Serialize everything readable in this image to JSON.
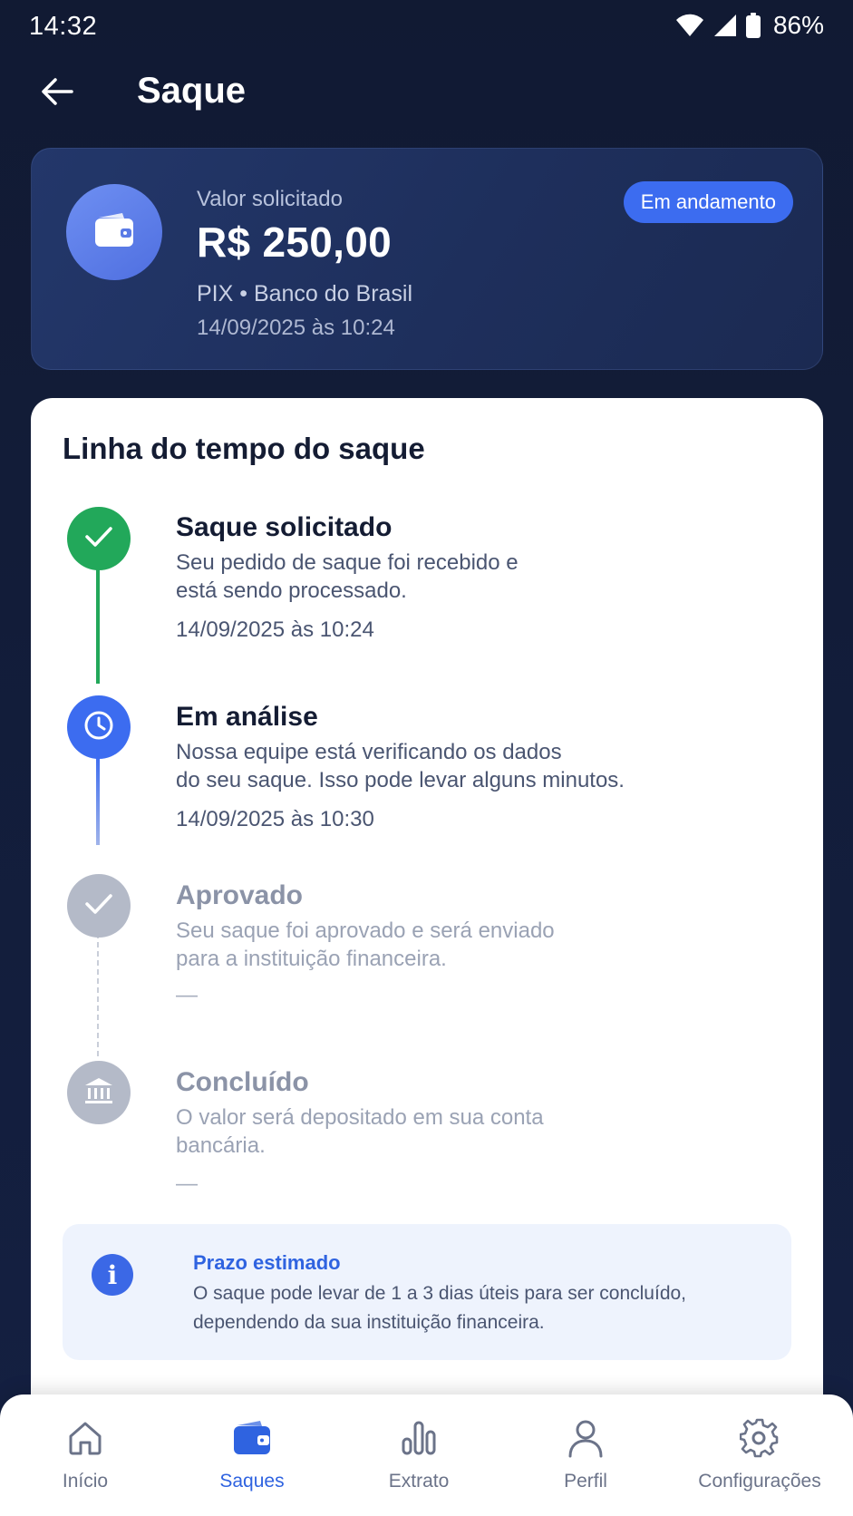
{
  "status_bar": {
    "time": "14:32",
    "battery": "86%"
  },
  "header": {
    "title": "Saque",
    "back_icon": "arrow-left-icon"
  },
  "summary": {
    "label": "Valor solicitado",
    "amount": "R$ 250,00",
    "method": "PIX • Banco do Brasil",
    "date": "14/09/2025  às 10:24",
    "status": "Em andamento",
    "icon": "wallet-icon"
  },
  "timeline": {
    "title": "Linha do tempo do saque",
    "steps": [
      {
        "title": "Saque solicitado",
        "desc_line1": "Seu pedido de saque foi recebido e",
        "desc_line2": "está sendo processado.",
        "date": "14/09/2025  às 10:24",
        "state": "done",
        "icon": "check-icon"
      },
      {
        "title": "Em análise",
        "desc_line1": "Nossa equipe está verificando os dados",
        "desc_line2": "do seu saque. Isso pode levar alguns minutos.",
        "date": "14/09/2025  às 10:30",
        "state": "current",
        "icon": "clock-icon"
      },
      {
        "title": "Aprovado",
        "desc_line1": "Seu saque foi aprovado e será enviado",
        "desc_line2": "para a instituição financeira.",
        "date": "—",
        "state": "pending",
        "icon": "check-icon"
      },
      {
        "title": "Concluído",
        "desc_line1": "O valor será depositado em sua conta",
        "desc_line2": "bancária.",
        "date": "—",
        "state": "pending",
        "icon": "bank-icon"
      }
    ]
  },
  "info": {
    "title": "Prazo estimado",
    "line1": "O saque pode levar de 1 a 3 dias úteis para ser concluído,",
    "line2": "dependendo da sua instituição financeira."
  },
  "bottom_nav": [
    {
      "label": "Início",
      "icon": "home-icon",
      "active": false
    },
    {
      "label": "Saques",
      "icon": "wallet-icon",
      "active": true
    },
    {
      "label": "Extrato",
      "icon": "bar-chart-icon",
      "active": false
    },
    {
      "label": "Perfil",
      "icon": "user-icon",
      "active": false
    },
    {
      "label": "Configurações",
      "icon": "gear-icon",
      "active": false
    }
  ],
  "colors": {
    "background": "#121c36",
    "accent": "#3c6cf0",
    "success": "#22a85a",
    "muted": "#b4bac8"
  }
}
